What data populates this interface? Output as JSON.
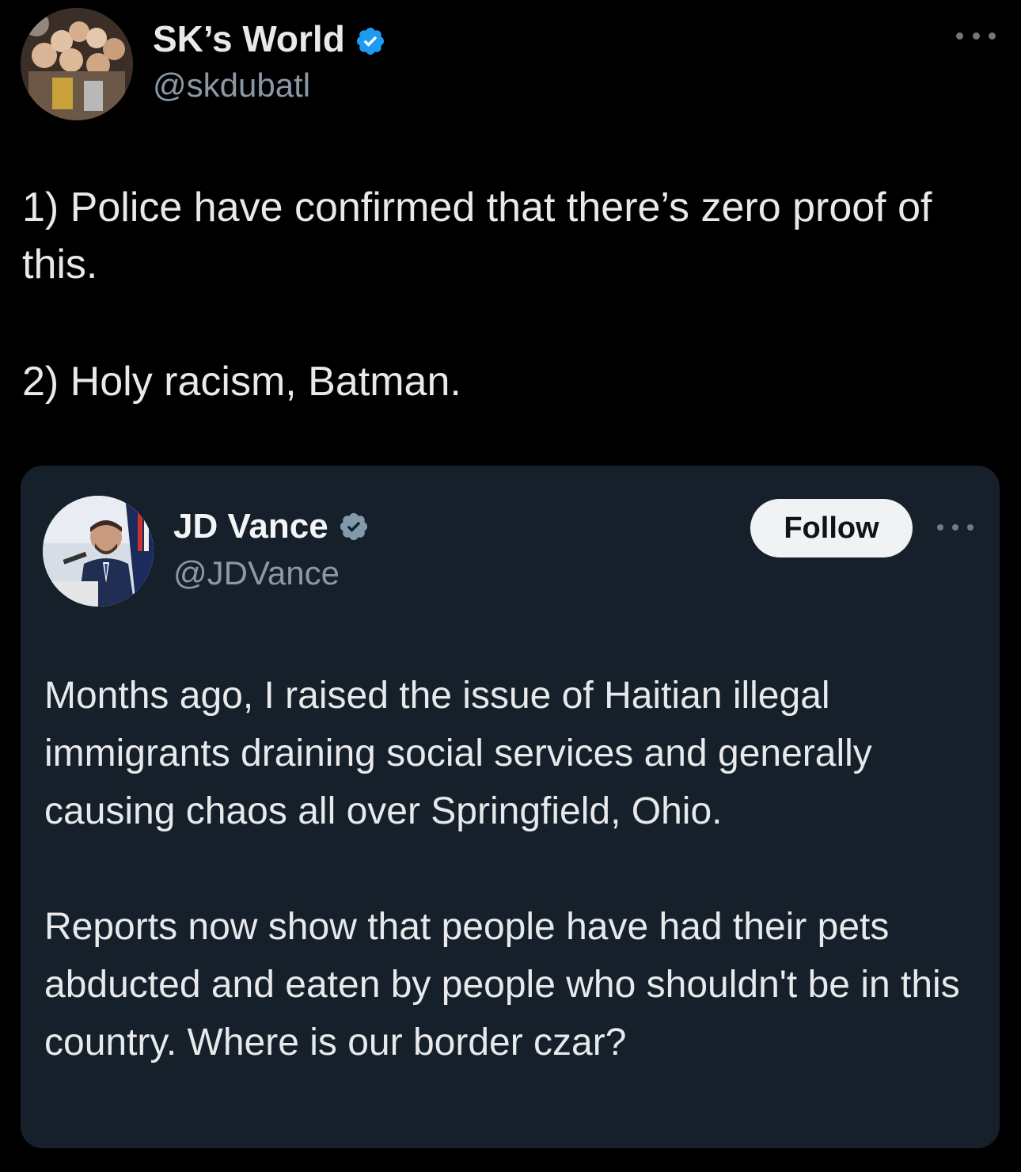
{
  "tweet": {
    "author": {
      "display_name": "SK’s World",
      "handle": "@skdubatl",
      "verified": true,
      "verified_icon": "verified-badge-icon",
      "verified_color": "#1d9bf0"
    },
    "body": {
      "line1": "1) Police have confirmed that there’s zero proof of this.",
      "line2": "2) Holy racism, Batman."
    },
    "more_icon": "more-options-icon"
  },
  "quoted_tweet": {
    "author": {
      "display_name": "JD Vance",
      "handle": "@JDVance",
      "verified": true,
      "verified_icon": "verified-badge-gray-icon",
      "verified_color": "#829aab"
    },
    "follow_label": "Follow",
    "more_icon": "more-options-icon",
    "body": {
      "paragraph1": "Months ago, I raised the issue of Haitian illegal immigrants draining social services and generally causing chaos all over Springfield, Ohio.",
      "paragraph2": "Reports now show that people have had their pets abducted and eaten by people who shouldn't be in this country. Where is our border czar?"
    }
  },
  "colors": {
    "background": "#000000",
    "card_background": "#15202b",
    "text": "#e7e9ea",
    "secondary_text": "#8b98a5",
    "follow_button_bg": "#eff3f4"
  }
}
